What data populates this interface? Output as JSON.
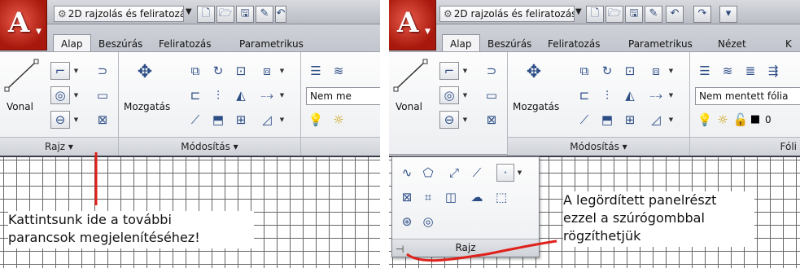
{
  "workspace_name": "2D rajzolás és feliratozás",
  "tabs": {
    "alap": "Alap",
    "beszuras": "Beszúrás",
    "feliratozas": "Feliratozás",
    "parametrikus": "Parametrikus",
    "nezet": "Nézet",
    "partial_k": "K"
  },
  "ribbon": {
    "vonal": "Vonal",
    "mozgatas": "Mozgatás",
    "rajz_panel": "Rajz ▾",
    "modositas_panel": "Módosítás ▾",
    "layer_combo_left": "Nem me",
    "layer_combo_right": "Nem mentett fólia",
    "layer_zero": "0",
    "folia_partial": "Fóli"
  },
  "flyout": {
    "panel_title": "Rajz"
  },
  "annotations": {
    "left_line1": "Kattintsunk ide a  további",
    "left_line2": "parancsok megjelenítéséhez!",
    "right_line1": "A legördített panelrészt",
    "right_line2": "ezzel a szúrógombbal",
    "right_line3": "rögzíthetjük"
  },
  "colors": {
    "accent_red": "#e0201a",
    "ribbon_bg": "#eceef1",
    "app_button": "#c02014"
  }
}
